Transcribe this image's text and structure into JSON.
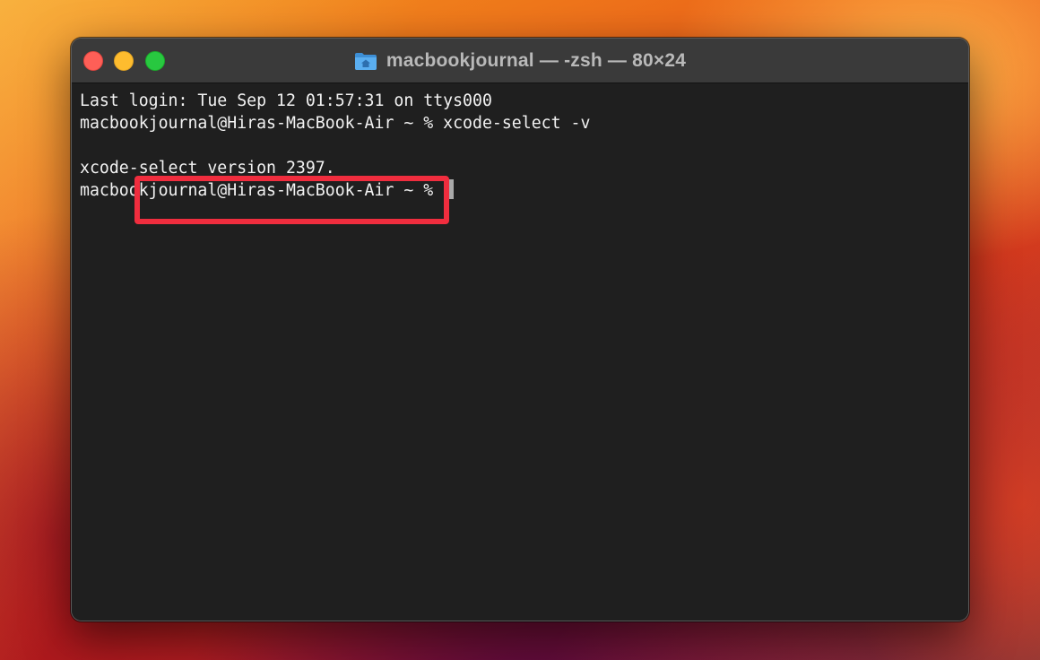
{
  "window": {
    "title": "macbookjournal — -zsh — 80×24",
    "folder_icon": "folder-home-icon",
    "buttons": {
      "close": "close-button",
      "minimize": "minimize-button",
      "maximize": "maximize-button"
    }
  },
  "terminal": {
    "lines": [
      "Last login: Tue Sep 12 01:57:31 on ttys000",
      "macbookjournal@Hiras-MacBook-Air ~ % xcode-select -v",
      "",
      "xcode-select version 2397.",
      "macbookjournal@Hiras-MacBook-Air ~ % "
    ]
  },
  "colors": {
    "traffic_close": "#fe5f57",
    "traffic_minimize": "#febc2e",
    "traffic_maximize": "#28c840",
    "highlight": "#f02d3e",
    "terminal_bg": "#1f1f1f",
    "terminal_text": "#f2f2f2"
  }
}
